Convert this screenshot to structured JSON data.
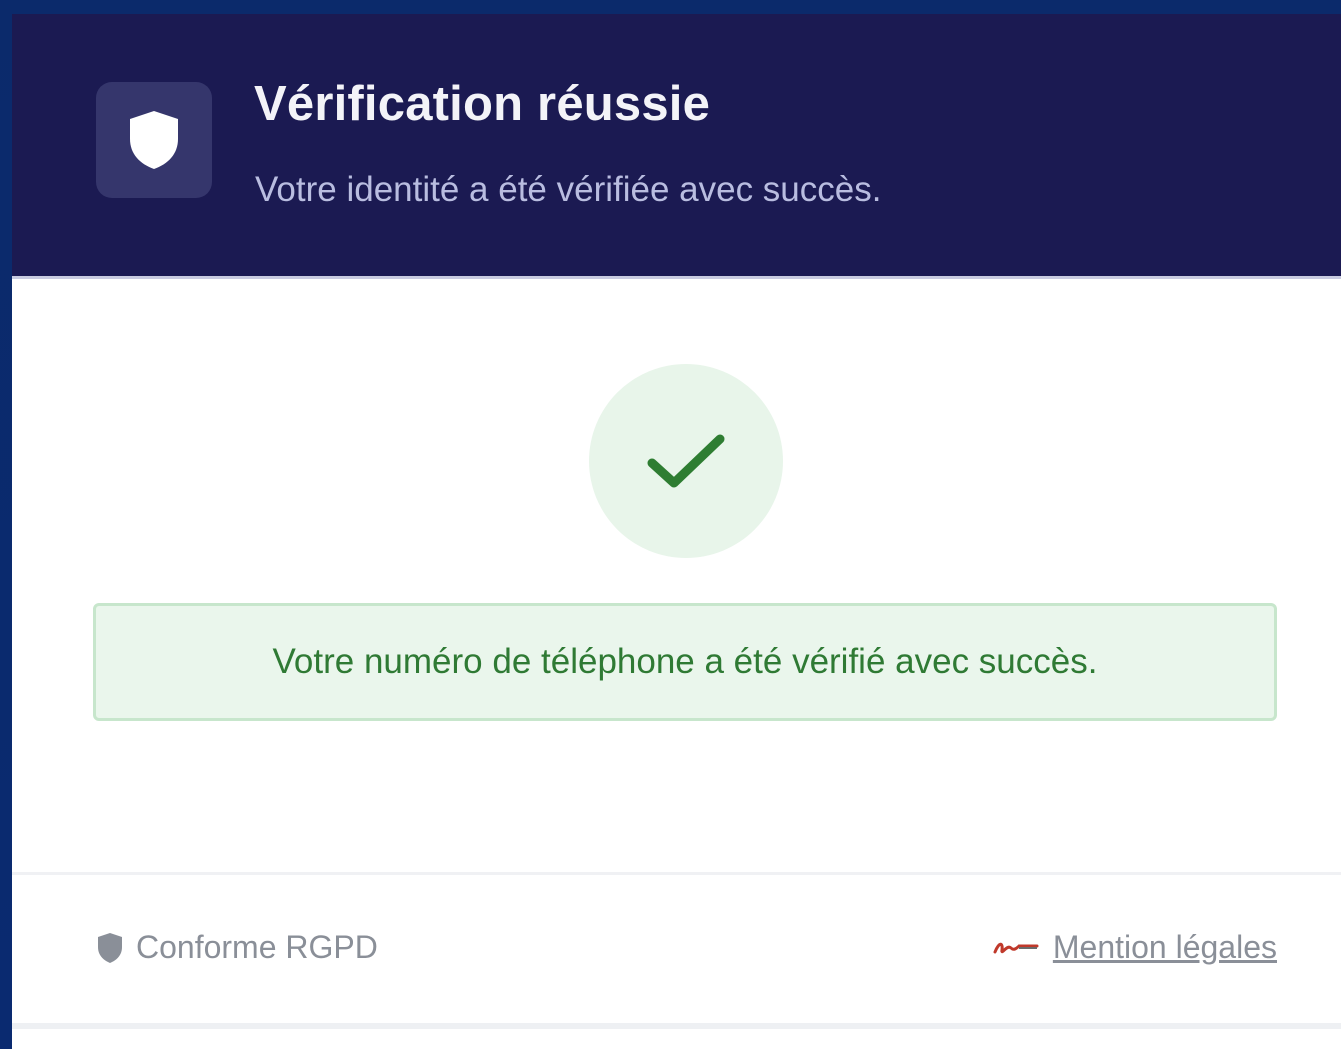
{
  "header": {
    "title": "Vérification réussie",
    "subtitle": "Votre identité a été vérifiée avec succès.",
    "icon": "shield-icon"
  },
  "status": {
    "icon": "checkmark-icon",
    "message": "Votre numéro de téléphone a été vérifié avec succès."
  },
  "footer": {
    "compliance_label": "Conforme RGPD",
    "compliance_icon": "shield-icon",
    "legal_link_label": "Mention légales",
    "legal_icon": "signature-icon"
  },
  "colors": {
    "header_bg": "#1b1a52",
    "success_green": "#2f7a34",
    "success_bg": "#eaf6ec",
    "muted_text": "#8a8f98"
  }
}
